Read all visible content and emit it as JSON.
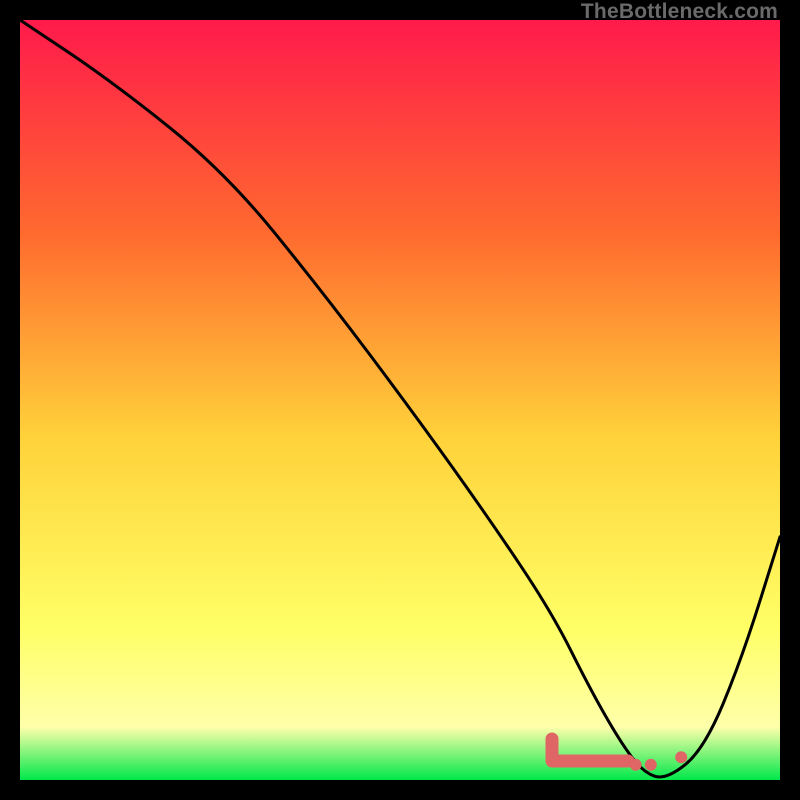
{
  "attribution": "TheBottleneck.com",
  "colors": {
    "gradient_top": "#ff1a4b",
    "gradient_mid_upper": "#ff6a2f",
    "gradient_mid": "#ffd23a",
    "gradient_lower": "#ffff66",
    "gradient_near_bottom": "#ffffaa",
    "gradient_bottom": "#00e84a",
    "curve": "#000000",
    "marker_fill": "#e06666",
    "marker_stroke": "#c94f4f"
  },
  "chart_data": {
    "type": "line",
    "title": "",
    "xlabel": "",
    "ylabel": "",
    "xlim": [
      0,
      100
    ],
    "ylim": [
      0,
      100
    ],
    "grid": false,
    "legend": false,
    "series": [
      {
        "name": "bottleneck-curve",
        "x": [
          0,
          12,
          27,
          40,
          52,
          62,
          70,
          75,
          79,
          82,
          85,
          90,
          95,
          100
        ],
        "y": [
          100,
          92,
          80,
          64,
          48,
          34,
          22,
          12,
          5,
          1,
          0,
          4,
          16,
          32
        ]
      }
    ],
    "markers": [
      {
        "name": "optimal-band",
        "shape": "rounded-segment",
        "x_range": [
          70,
          80
        ],
        "y": 2.5
      },
      {
        "name": "marker-dot-1",
        "shape": "dot",
        "x": 81,
        "y": 2
      },
      {
        "name": "marker-dot-2",
        "shape": "dot",
        "x": 83,
        "y": 2
      },
      {
        "name": "marker-dot-3",
        "shape": "dot",
        "x": 87,
        "y": 3
      }
    ]
  }
}
